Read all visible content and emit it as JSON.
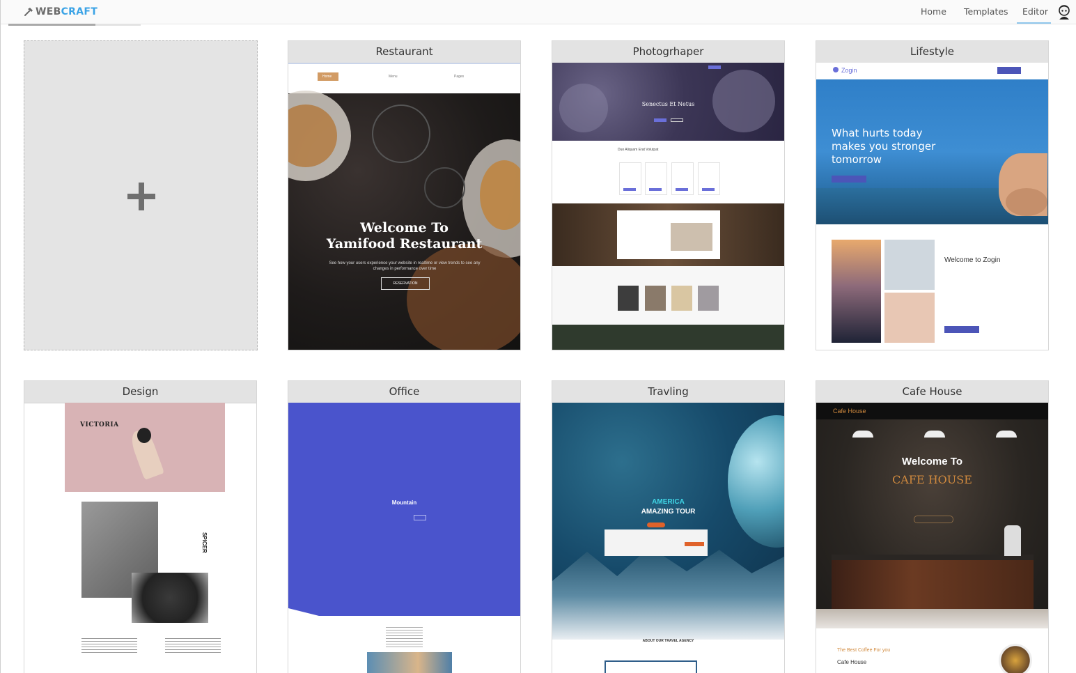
{
  "brand": {
    "prefix": "WEB",
    "suffix": "CRAFT",
    "icon": "hammer-icon"
  },
  "nav": {
    "home": "Home",
    "templates": "Templates",
    "editor": "Editor",
    "active": "Editor"
  },
  "new_card": {
    "icon": "plus-icon"
  },
  "cards": {
    "restaurant": {
      "title": "Restaurant",
      "menu": [
        "Home",
        "Menu",
        "Pages"
      ],
      "heading1": "Welcome To",
      "heading2": "Yamifood Restaurant",
      "body": "See how your users experience your website in realtime or view trends to see any changes in performance over time",
      "button": "RESERVATION"
    },
    "photographer": {
      "title": "Photogrhaper",
      "hero": "Senectus Et Netus",
      "section1": "Duo Aliquam Erat Volutpat"
    },
    "lifestyle": {
      "title": "Lifestyle",
      "logo": "Zogin",
      "hero": [
        "What hurts today",
        "makes you stronger",
        "tomorrow"
      ],
      "welcome": "Welcome to Zogin"
    },
    "design": {
      "title": "Design",
      "brand": "VICTORIA",
      "side": "SPICER"
    },
    "office": {
      "title": "Office",
      "hero": "Mountain"
    },
    "traveling": {
      "title": "Travling",
      "hero1": "AMERICA",
      "hero2": "AMAZING TOUR",
      "section": "ABOUT OUR TRAVEL AGENCY"
    },
    "cafe": {
      "title": "Cafe House",
      "logo": "Cafe House",
      "heading1": "Welcome To",
      "heading2": "CAFE HOUSE",
      "tagline": "The Best Coffee For you",
      "sub": "Cafe House"
    }
  },
  "colors": {
    "brand_blue": "#3ba3e6",
    "office_blue": "#4a54cc",
    "design_pink": "#d8b3b5",
    "cafe_orange": "#d18a3e",
    "lifestyle_sky": "#2f7fc8"
  }
}
